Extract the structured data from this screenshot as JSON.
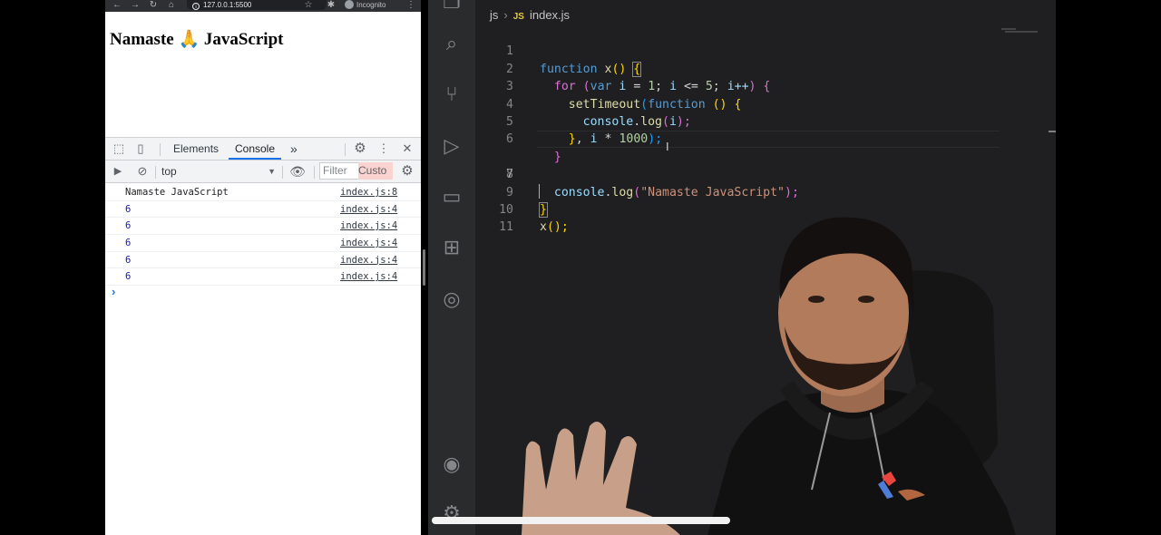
{
  "browser": {
    "url": "127.0.0.1:5500",
    "incognito_label": "Incognito",
    "page_heading": "Namaste 🙏 JavaScript"
  },
  "devtools": {
    "tabs": [
      "Elements",
      "Console"
    ],
    "more_tabs": "»",
    "context": "top",
    "filter_placeholder": "Filter",
    "custom_levels": "Custo",
    "logs": [
      {
        "message": "Namaste JavaScript",
        "source": "index.js:8",
        "numeric": false
      },
      {
        "message": "6",
        "source": "index.js:4",
        "numeric": true
      },
      {
        "message": "6",
        "source": "index.js:4",
        "numeric": true
      },
      {
        "message": "6",
        "source": "index.js:4",
        "numeric": true
      },
      {
        "message": "6",
        "source": "index.js:4",
        "numeric": true
      },
      {
        "message": "6",
        "source": "index.js:4",
        "numeric": true
      }
    ],
    "prompt": "›"
  },
  "editor": {
    "breadcrumb": {
      "folder": "js",
      "file_badge": "JS",
      "file": "index.js"
    },
    "line_numbers": [
      "1",
      "2",
      "3",
      "4",
      "5",
      "6",
      "7",
      "8",
      "9",
      "10",
      "11"
    ],
    "code": {
      "l1": [
        "function",
        "x",
        "()",
        "{"
      ],
      "l2": [
        "for",
        "(",
        "var",
        "i",
        "=",
        "1",
        ";",
        "i",
        "<=",
        "5",
        ";",
        "i++",
        ")",
        "{"
      ],
      "l3": [
        "setTimeout",
        "(",
        "function",
        "()",
        "{"
      ],
      "l4": [
        "console",
        ".",
        "log",
        "(",
        "i",
        ");"
      ],
      "l5": [
        "}",
        ",",
        "i",
        "*",
        "1000",
        ");"
      ],
      "l6": [
        "}"
      ],
      "l8": [
        "console",
        ".",
        "log",
        "(",
        "\"Namaste JavaScript\"",
        ");"
      ],
      "l9": [
        "}"
      ],
      "l10": [
        "x",
        "();"
      ]
    }
  },
  "colors": {
    "keyword": "#569cd6",
    "function": "#dcdcaa",
    "string": "#ce9178",
    "number": "#b5cea8",
    "variable": "#9cdcfe",
    "devtools_accent": "#1a73e8"
  },
  "icons": [
    "back-icon",
    "forward-icon",
    "reload-icon",
    "home-icon",
    "star-icon",
    "extensions-icon",
    "menu-dots-icon",
    "inspect-icon",
    "device-toggle-icon",
    "settings-gear-icon",
    "close-icon",
    "sidebar-toggle-icon",
    "clear-console-icon",
    "eye-icon",
    "explorer-icon",
    "search-icon",
    "source-control-icon",
    "run-debug-icon",
    "remote-explorer-icon",
    "extensions-icon",
    "git-graph-icon",
    "account-icon",
    "manage-gear-icon"
  ]
}
